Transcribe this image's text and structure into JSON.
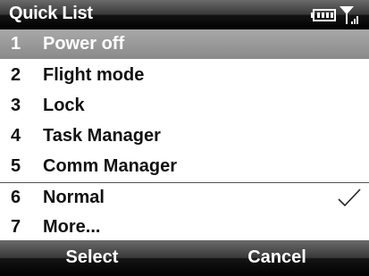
{
  "title": "Quick List",
  "status_icons": [
    "battery-icon",
    "signal-icon"
  ],
  "menu": {
    "items": [
      {
        "num": "1",
        "label": "Power off",
        "selected": true
      },
      {
        "num": "2",
        "label": "Flight mode"
      },
      {
        "num": "3",
        "label": "Lock"
      },
      {
        "num": "4",
        "label": "Task Manager"
      },
      {
        "num": "5",
        "label": "Comm Manager"
      },
      {
        "num": "6",
        "label": "Normal",
        "checked": true
      },
      {
        "num": "7",
        "label": "More..."
      }
    ]
  },
  "softkeys": {
    "left": "Select",
    "right": "Cancel"
  },
  "colors": {
    "selected_row": "#8f8f8f",
    "bar_dark": "#000000",
    "bar_light": "#6a6a6a"
  }
}
